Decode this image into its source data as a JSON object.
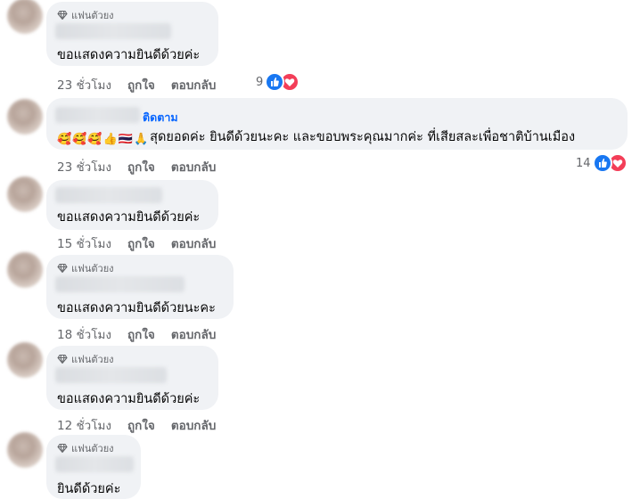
{
  "comments": [
    {
      "badge": "แฟนตัวยง",
      "text": "ขอแสดงความยินดีด้วยค่ะ",
      "time": "23 ชั่วโมง",
      "like": "ถูกใจ",
      "reply": "ตอบกลับ",
      "reaction_count": "9"
    },
    {
      "follow": "ติดตาม",
      "emojis": [
        "🥰",
        "🥰",
        "🥰",
        "👍",
        "🇹🇭",
        "🙏"
      ],
      "text": "สุดยอดค่ะ ยินดีด้วยนะคะ และขอบพระคุณมากค่ะ ที่เสียสละเพื่อชาติบ้านเมือง",
      "time": "23 ชั่วโมง",
      "like": "ถูกใจ",
      "reply": "ตอบกลับ",
      "reaction_count": "14"
    },
    {
      "text": "ขอแสดงความยินดีด้วยค่ะ",
      "time": "15 ชั่วโมง",
      "like": "ถูกใจ",
      "reply": "ตอบกลับ"
    },
    {
      "badge": "แฟนตัวยง",
      "text": "ขอแสดงความยินดีด้วยนะคะ",
      "time": "18 ชั่วโมง",
      "like": "ถูกใจ",
      "reply": "ตอบกลับ"
    },
    {
      "badge": "แฟนตัวยง",
      "text": "ขอแสดงความยินดีด้วยค่ะ",
      "time": "12 ชั่วโมง",
      "like": "ถูกใจ",
      "reply": "ตอบกลับ"
    },
    {
      "badge": "แฟนตัวยง",
      "text": "ยินดีด้วยค่ะ"
    }
  ],
  "colors": {
    "bubble": "#f0f2f5",
    "meta": "#65676b",
    "follow": "#0866ff",
    "like": "#1877f2",
    "love": "#f33e58"
  }
}
